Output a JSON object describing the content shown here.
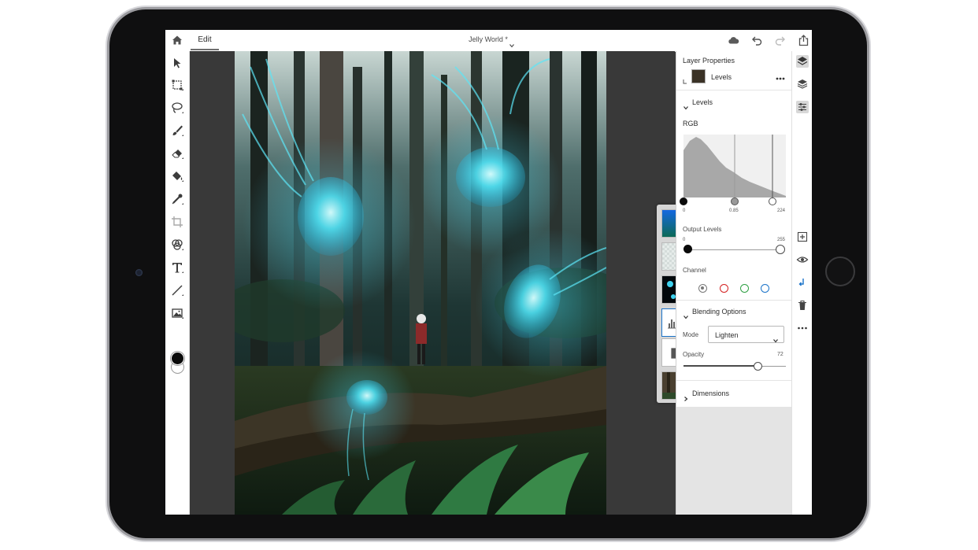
{
  "app": {
    "document_title": "Jelly World *",
    "mode_tab": "Edit"
  },
  "toolbar": {
    "tools": [
      "select-icon",
      "transform-icon",
      "lasso-icon",
      "brush-icon",
      "eraser-icon",
      "fill-icon",
      "healing-icon",
      "crop-icon",
      "adjust-icon",
      "type-icon",
      "line-icon",
      "place-image-icon"
    ],
    "foreground_color": "#0a0a0a",
    "background_color": "#ffffff"
  },
  "panel": {
    "header": "Layer Properties",
    "layer_name": "Levels",
    "levels_section": "Levels",
    "channel_label_top": "RGB",
    "input_levels": {
      "min": "0",
      "mid": "0.85",
      "max": "224"
    },
    "output_levels_label": "Output Levels",
    "output_levels": {
      "min": "0",
      "max": "255"
    },
    "channel_label": "Channel",
    "channel_colors": [
      "#777777",
      "#d42020",
      "#2ea043",
      "#1a73c9"
    ],
    "blending_section": "Blending Options",
    "mode_label": "Mode",
    "mode_value": "Lighten",
    "opacity_label": "Opacity",
    "opacity_value": "72",
    "opacity_fraction": 0.72,
    "dimensions_section": "Dimensions"
  },
  "layers": [
    "gradient-layer",
    "transparent-layer",
    "jellyfish-layer",
    "levels-adjustment",
    "mask-adjustment",
    "forest-photo-layer"
  ]
}
